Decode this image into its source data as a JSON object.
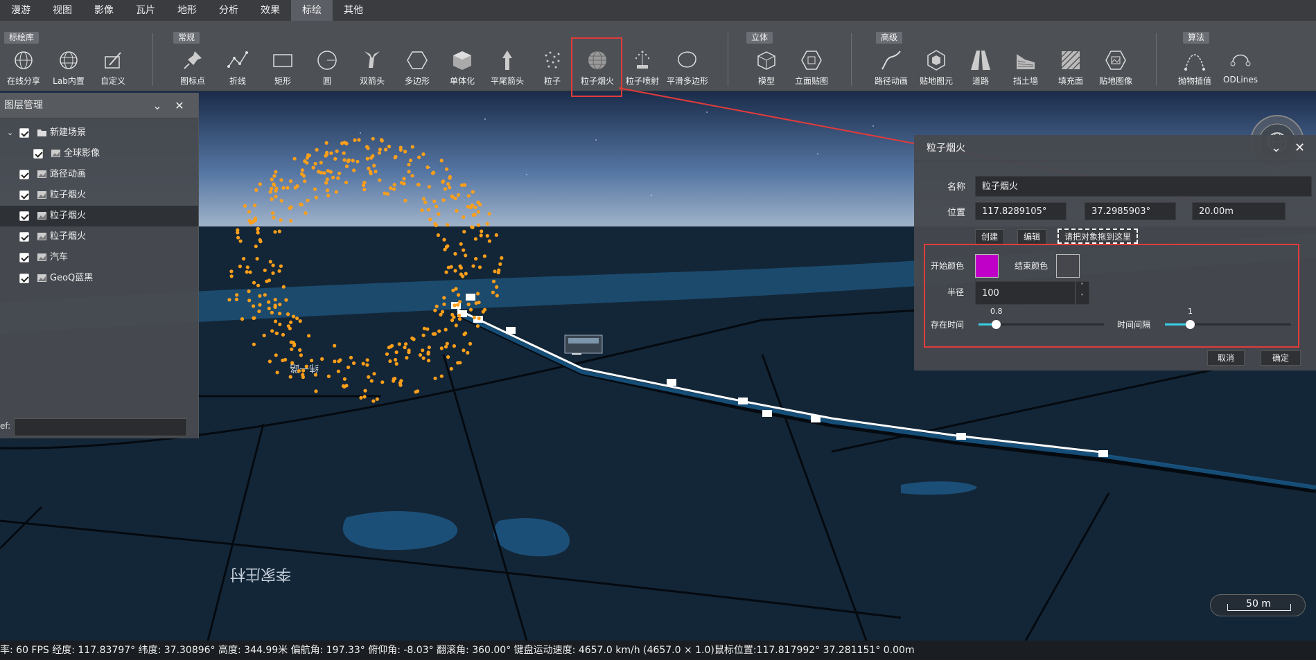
{
  "menu": {
    "tabs": [
      "漫游",
      "视图",
      "影像",
      "瓦片",
      "地形",
      "分析",
      "效果",
      "标绘",
      "其他"
    ],
    "active_tab": "标绘"
  },
  "ribbon": {
    "groups": {
      "library": "标绘库",
      "common": "常规",
      "solid": "立体",
      "advanced": "高级",
      "algorithm": "算法"
    },
    "tools": {
      "online_share": "在线分享",
      "lab_builtin": "Lab内置",
      "custom": "自定义",
      "icon_point": "图标点",
      "polyline": "折线",
      "rectangle": "矩形",
      "circle": "圆",
      "double_arrow": "双箭头",
      "polygon": "多边形",
      "monomer": "单体化",
      "flat_arrow": "平尾箭头",
      "particle": "粒子",
      "particle_firework": "粒子烟火",
      "particle_emit": "粒子喷射",
      "smooth_polygon": "平滑多边形",
      "model": "模型",
      "facade_texture": "立面贴图",
      "path_animation": "路径动画",
      "ground_primitive": "贴地图元",
      "road": "道路",
      "retaining_wall": "挡土墙",
      "fill_surface": "填充面",
      "ground_image": "贴地图像",
      "parabola": "抛物插值",
      "odlines": "ODLines"
    },
    "highlighted_tool": "粒子烟火"
  },
  "layer_panel": {
    "title": "图层管理",
    "items": [
      {
        "label": "新建场景",
        "type": "folder",
        "checked": true
      },
      {
        "label": "全球影像",
        "type": "layer",
        "checked": true
      },
      {
        "label": "路径动画",
        "type": "layer",
        "checked": true
      },
      {
        "label": "粒子烟火",
        "type": "layer",
        "checked": true
      },
      {
        "label": "粒子烟火",
        "type": "layer",
        "checked": true,
        "selected": true
      },
      {
        "label": "粒子烟火",
        "type": "layer",
        "checked": true
      },
      {
        "label": "汽车",
        "type": "layer",
        "checked": true
      },
      {
        "label": "GeoQ蓝黑",
        "type": "layer",
        "checked": true
      }
    ],
    "ref_label": "ef:",
    "ref_value": ""
  },
  "dialog": {
    "title": "粒子烟火",
    "name_label": "名称",
    "name_value": "粒子烟火",
    "position_label": "位置",
    "lon": "117.8289105°",
    "lat": "37.2985903°",
    "height": "20.00m",
    "create_button": "创建",
    "edit_button": "编辑",
    "drop_target": "请把对象拖到这里",
    "start_color_label": "开始颜色",
    "start_color": "#c000c8",
    "end_color_label": "结束颜色",
    "end_color": "#45474c",
    "radius_label": "半径",
    "radius_value": "100",
    "lifetime_label": "存在时间",
    "lifetime_value": "0.8",
    "lifetime_fraction": 0.14,
    "interval_label": "时间间隔",
    "interval_value": "1",
    "interval_fraction": 0.2,
    "cancel_button": "取消",
    "ok_button": "确定"
  },
  "map": {
    "scale_text": "50 m",
    "particle_color": "#ff9f1a",
    "road_labels": [
      "纬一路",
      "李家庄村"
    ]
  },
  "status_bar": {
    "text": "率: 60 FPS 经度: 117.83797° 纬度: 37.30896° 高度: 344.99米 偏航角: 197.33° 俯仰角: -8.03° 翻滚角: 360.00° 键盘运动速度: 4657.0 km/h (4657.0 × 1.0)鼠标位置:117.817992° 37.281151° 0.00m"
  },
  "colors": {
    "accent": "#38d0e6",
    "highlight": "#e23b3b"
  }
}
